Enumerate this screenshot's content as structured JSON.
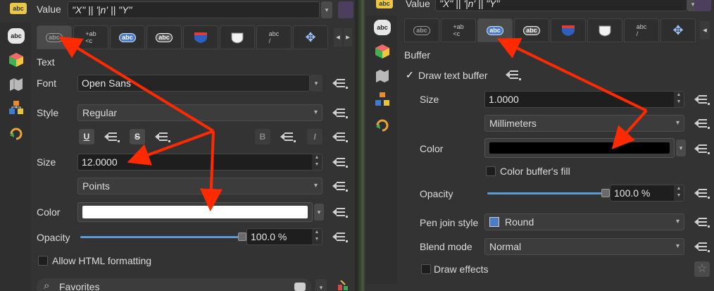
{
  "left": {
    "value_label": "Value",
    "expression": "\"X\" ||  '|n' || \"Y\"",
    "section_title": "Text",
    "font_label": "Font",
    "font_value": "Open Sans",
    "style_label": "Style",
    "style_value": "Regular",
    "underline": "U",
    "strike": "S",
    "bold": "B",
    "italic": "I",
    "size_label": "Size",
    "size_value": "12.0000",
    "unit_value": "Points",
    "color_label": "Color",
    "color_value": "#ffffff",
    "opacity_label": "Opacity",
    "opacity_value": "100.0 %",
    "opacity_fraction": 1.0,
    "html_label": "Allow HTML formatting",
    "search_value": "Favorites",
    "tabs": [
      "abc",
      "+ab",
      "abc",
      "abc",
      "shield",
      "balloon",
      "abc",
      "move"
    ],
    "active_tab": 0
  },
  "right": {
    "value_label": "Value",
    "expression": "\"X\" ||  '|n' || \"Y\"",
    "section_title": "Buffer",
    "draw_buffer_label": "Draw text buffer",
    "check_mark": "✓",
    "size_label": "Size",
    "size_value": "1.0000",
    "unit_value": "Millimeters",
    "color_label": "Color",
    "color_value": "#000000",
    "fill_label": "Color buffer's fill",
    "opacity_label": "Opacity",
    "opacity_value": "100.0 %",
    "opacity_fraction": 1.0,
    "pen_label": "Pen join style",
    "pen_value": "Round",
    "blend_label": "Blend mode",
    "blend_value": "Normal",
    "effects_label": "Draw effects",
    "active_tab": 2
  },
  "icons": {
    "tab_label": "abc",
    "scroll_left": "◂",
    "scroll_right": "▸",
    "dropdown": "▾",
    "spin": "▴▾",
    "search": "⌕",
    "star": "☆"
  },
  "colors": {
    "accent_arrow": "#ff2a00",
    "slider": "#5b9bd5",
    "panel_bg": "#333333"
  }
}
